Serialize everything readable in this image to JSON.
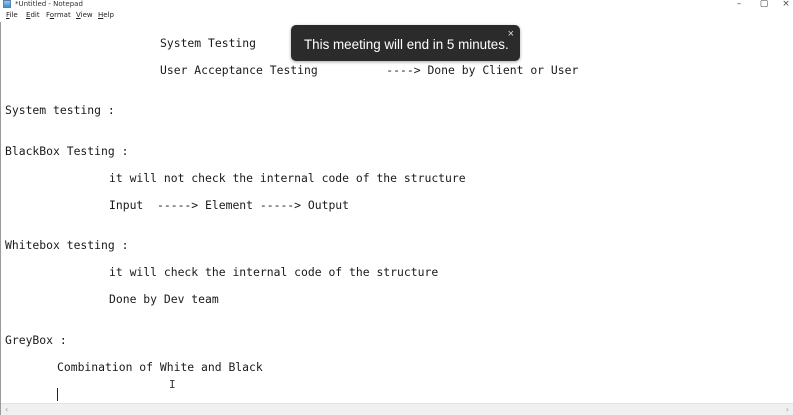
{
  "window": {
    "title": "*Untitled - Notepad",
    "minimize_glyph": "–",
    "maximize_glyph": "▢",
    "close_glyph": "×"
  },
  "menu": {
    "items": [
      {
        "key": "F",
        "rest": "ile"
      },
      {
        "key": "E",
        "rest": "dit"
      },
      {
        "key": "",
        "pre": "F",
        "under": "o",
        "rest": "rmat"
      },
      {
        "key": "V",
        "rest": "iew"
      },
      {
        "key": "H",
        "rest": "elp"
      }
    ]
  },
  "editor": {
    "lines": [
      "System Testing",
      "User Acceptance Testing          ----> Done by Client or User",
      "System testing :",
      "BlackBox Testing :",
      "it will not check the internal code of the structure",
      "Input  -----> Element -----> Output",
      "Whitebox testing :",
      "it will check the internal code of the structure",
      "Done by Dev team",
      "GreyBox :",
      "Combination of White and Black"
    ],
    "ibeam_glyph": "I"
  },
  "toast": {
    "message": "This meeting will end in 5 minutes.",
    "close_glyph": "×"
  },
  "scrollbar": {
    "left_arrow": "‹",
    "right_arrow": "›"
  }
}
